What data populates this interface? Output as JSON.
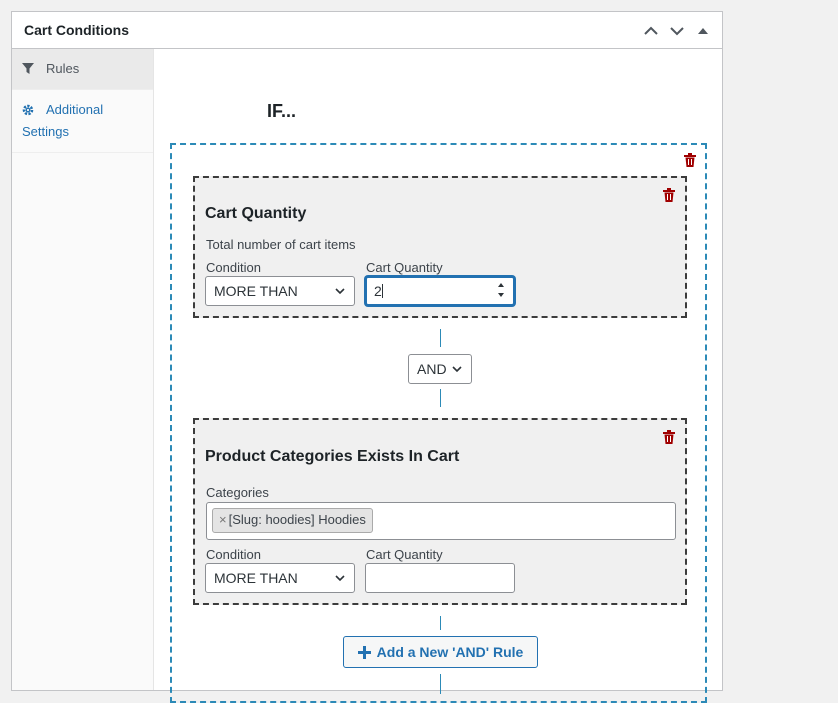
{
  "metabox": {
    "title": "Cart Conditions"
  },
  "sidebar": {
    "items": [
      {
        "label": "Rules",
        "icon": "filter-icon"
      },
      {
        "label": "Additional Settings",
        "icon": "gear-icon"
      }
    ]
  },
  "main": {
    "if_label": "IF...",
    "rules": [
      {
        "title": "Cart Quantity",
        "description": "Total number of cart items",
        "condition_label": "Condition",
        "condition_value": "MORE THAN",
        "quantity_label": "Cart Quantity",
        "quantity_value": "2"
      },
      {
        "title": "Product Categories Exists In Cart",
        "categories_label": "Categories",
        "categories_tag": "[Slug: hoodies] Hoodies",
        "condition_label": "Condition",
        "condition_value": "MORE THAN",
        "quantity_label": "Cart Quantity",
        "quantity_value": ""
      }
    ],
    "logic_operator": "AND",
    "add_rule_label": "Add a New 'AND' Rule"
  },
  "colors": {
    "accent": "#2271b1",
    "group_border": "#2c8ab7",
    "trash": "#a00000"
  }
}
